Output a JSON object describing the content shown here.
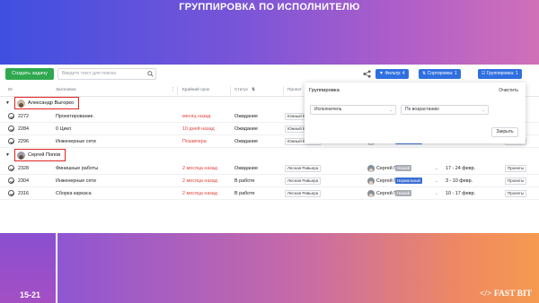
{
  "banner": {
    "title": "ГРУППИРОВКА ПО ИСПОЛНИТЕЛЮ",
    "page_num": "15-21",
    "logo": "</> FAST BIT"
  },
  "toolbar": {
    "create_label": "Создать задачу",
    "search_placeholder": "Введите текст для поиска",
    "filter_chip": "Фильтр: 4",
    "sort_chip": "Сортировка: 1",
    "group_chip": "Группировка: 1"
  },
  "columns": {
    "id": "ID",
    "title": "Заголовок",
    "deadline": "Крайний срок",
    "status": "Статус",
    "project": "Проект"
  },
  "groups": [
    {
      "name": "Александр Выгорко",
      "rows": [
        {
          "id": "2272",
          "title": "Проектирование.",
          "deadline": "месяц назад",
          "status": "Ожидание",
          "project": "Южный Вы"
        },
        {
          "id": "2284",
          "title": "0 Цикл",
          "deadline": "10 дней назад",
          "status": "Ожидание",
          "project": "Южный Вы"
        },
        {
          "id": "2296",
          "title": "Инженерные сети",
          "deadline": "Позавчера",
          "status": "Ожидание",
          "project": "Южный Выгорко",
          "user": "Александр В",
          "priority": "Нормальный",
          "date": "14 - 27 апр.",
          "tag": "Проекты"
        }
      ]
    },
    {
      "name": "Сергей Попов",
      "rows": [
        {
          "id": "2328",
          "title": "Финишные работы",
          "deadline": "2 месяца назад",
          "status": "Ожидание",
          "project": "Лесная Ривьера",
          "user": "Сергей Попов",
          "priority": "Низкий",
          "date": "17 - 24 февр.",
          "tag": "Проекты"
        },
        {
          "id": "2304",
          "title": "Инженерные сети",
          "deadline": "2 месяца назад",
          "status": "В работе",
          "project": "Лесная Ривьера",
          "user": "Сергей Попов",
          "priority": "Нормальный",
          "date": "3 - 10 февр.",
          "tag": "Проекты"
        },
        {
          "id": "2316",
          "title": "Сборка каркаса",
          "deadline": "2 месяца назад",
          "status": "В работе",
          "project": "Лесная Ривьера",
          "user": "Сергей Попов",
          "priority": "Низкий",
          "date": "10 - 17 февр.",
          "tag": "Проекты"
        }
      ]
    }
  ],
  "popup": {
    "title": "Группировка",
    "clear": "Очистить",
    "field_value": "Исполнитель",
    "order_value": "По возрастанию",
    "close": "Закрыть"
  }
}
